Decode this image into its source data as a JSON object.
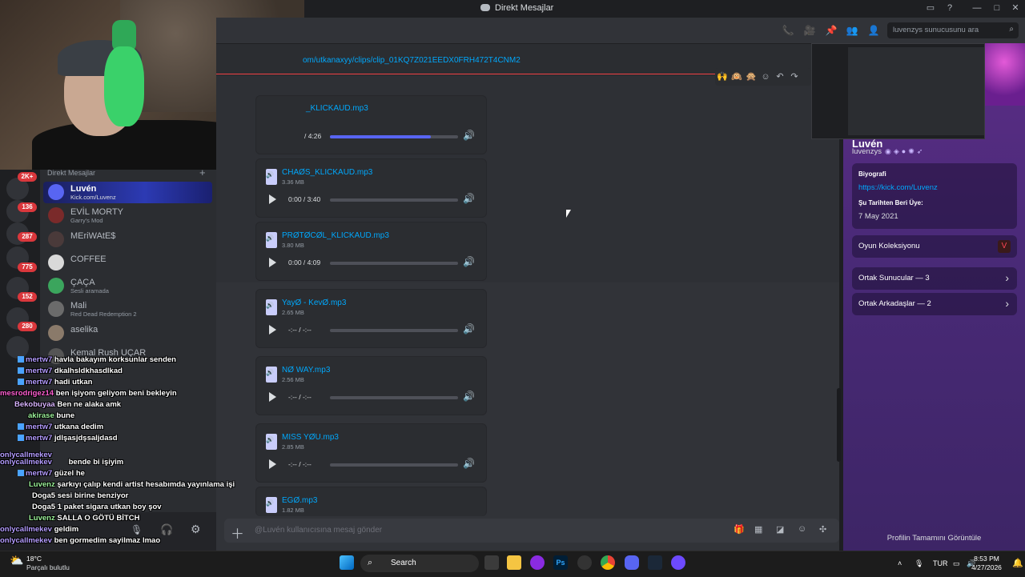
{
  "window": {
    "title": "Direkt Mesajlar"
  },
  "search": {
    "placeholder": "luvenzys sunucusunu ara"
  },
  "link_url": "om/utkanaxyy/clips/clip_01KQ7Z021EEDX0FRH472T4CNM2",
  "sidebar": {
    "header": "Direkt Mesajlar",
    "badges": [
      "2K+",
      "136",
      "287",
      "775",
      "152",
      "280"
    ],
    "dms": [
      {
        "name": "Luvén",
        "status": "Kick.com/Luvenz"
      },
      {
        "name": "EVİL MORTY",
        "status": "Garry's Mod"
      },
      {
        "name": "MEriWAtE$",
        "status": ""
      },
      {
        "name": "COFFEE",
        "status": ""
      },
      {
        "name": "ÇAÇA",
        "status": "Sesli aramada"
      },
      {
        "name": "Mali",
        "status": "Red Dead Redemption 2"
      },
      {
        "name": "aselika",
        "status": ""
      },
      {
        "name": "Kemal Rush UÇAR",
        "status": ""
      }
    ]
  },
  "attachments": [
    {
      "name": "_KLICKAUD.mp3",
      "size": "",
      "time": "/ 4:26",
      "progress": 0.6
    },
    {
      "name": "CHAØS_KLICKAUD.mp3",
      "size": "3.36 MB",
      "time": "0:00 / 3:40",
      "progress": 0
    },
    {
      "name": "PRØTØCØL_KLICKAUD.mp3",
      "size": "3.80 MB",
      "time": "0:00 / 4:09",
      "progress": 0
    },
    {
      "name": "YayØ - KevØ.mp3",
      "size": "2.65 MB",
      "time": "-:-- / -:--",
      "progress": 0
    },
    {
      "name": "NØ WAY.mp3",
      "size": "2.56 MB",
      "time": "-:-- / -:--",
      "progress": 0
    },
    {
      "name": "MISS YØU.mp3",
      "size": "2.85 MB",
      "time": "-:-- / -:--",
      "progress": 0
    },
    {
      "name": "EGØ.mp3",
      "size": "1.82 MB",
      "time": "",
      "progress": 0
    }
  ],
  "composer": {
    "placeholder": "@Luvén kullanıcısına mesaj gönder"
  },
  "profile": {
    "display_name": "Luvén",
    "username": "luvenzys",
    "bio_label": "Biyografi",
    "bio_link": "https://kick.com/Luvenz",
    "member_since_label": "Şu Tarihten Beri Üye:",
    "member_since": "7 May 2021",
    "game_collection": "Oyun Koleksiyonu",
    "mutual_servers": "Ortak Sunucular — 3",
    "mutual_friends": "Ortak Arkadaşlar — 2",
    "view_full": "Profilin Tamamını Görüntüle"
  },
  "chat": [
    {
      "user": "mertw7",
      "msg": "havla bakayım korksunlar senden"
    },
    {
      "user": "mertw7",
      "msg": "dkalhsldkhasdlkad"
    },
    {
      "user": "mertw7",
      "msg": "hadi utkan"
    },
    {
      "user": "mesrodrigez14",
      "msg": "ben işiyom geliyom beni bekleyin"
    },
    {
      "user": "Bekobuyaa",
      "msg": "Ben ne alaka amk"
    },
    {
      "user": "akirase",
      "msg": "bune"
    },
    {
      "user": "mertw7",
      "msg": "utkana dedim"
    },
    {
      "user": "mertw7",
      "msg": "jdlşasjdşsaljdasd"
    },
    {
      "user": "onlycallmekev",
      "msg": ""
    },
    {
      "user": "onlycallmekev",
      "msg": "bende bi işiyim"
    },
    {
      "user": "mertw7",
      "msg": "güzel he"
    },
    {
      "user": "Luvenz",
      "msg": "şarkıyı çalıp kendi artist hesabımda yayınlama işi"
    },
    {
      "user": "Doga5",
      "msg": "sesi birine benziyor"
    },
    {
      "user": "Doga5",
      "msg": "1 paket sigara utkan boy şov"
    },
    {
      "user": "Luvenz",
      "msg": "SALLA O GÖTÜ BİTCH"
    },
    {
      "user": "onlycallmekev",
      "msg": "geldim"
    },
    {
      "user": "onlycallmekev",
      "msg": "ben gormedim sayilmaz lmao"
    }
  ],
  "taskbar": {
    "temp": "18°C",
    "weather": "Parçalı bulutlu",
    "search_label": "Search",
    "lang": "TUR",
    "time": "8:53 PM",
    "date": "4/27/2026"
  },
  "colors": {
    "accent": "#5865f2",
    "link": "#00a8fc",
    "profile_bg": "#5b2d86",
    "danger": "#da373c"
  }
}
